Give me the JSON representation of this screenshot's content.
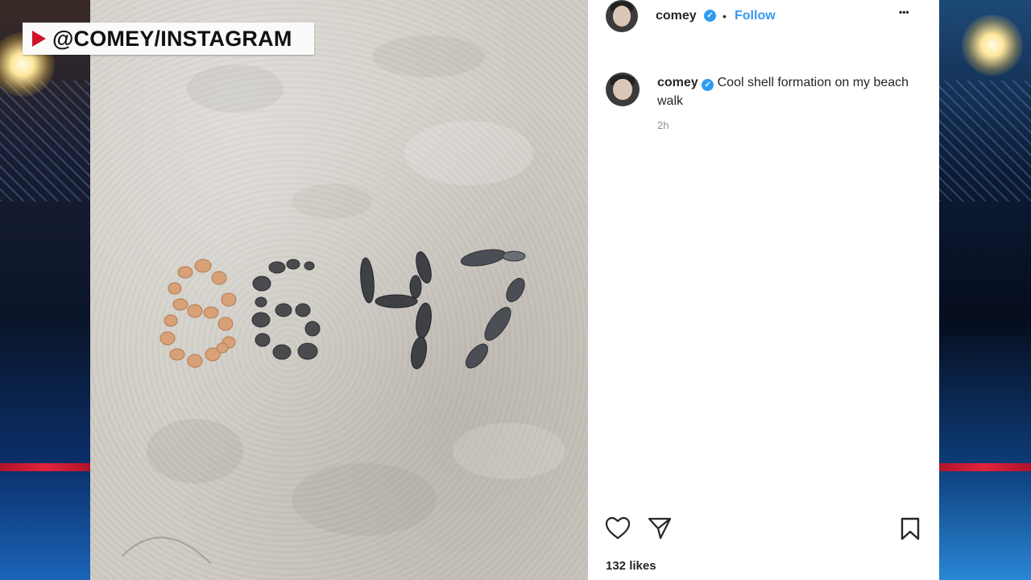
{
  "chyron": {
    "text": "@COMEY/INSTAGRAM"
  },
  "photo": {
    "description_icon": "beach-shell-photo",
    "shell_digits": [
      "8",
      "6",
      "4",
      "7"
    ]
  },
  "post": {
    "header": {
      "username": "comey",
      "separator": "•",
      "follow_label": "Follow",
      "more_label": "•••"
    },
    "caption": {
      "username": "comey",
      "text": "Cool shell formation on my beach walk"
    },
    "timestamp": "2h",
    "likes": "132 likes"
  },
  "colors": {
    "follow_blue": "#3897f0",
    "verified_blue": "#2f9bf0",
    "chyron_red": "#d0122d"
  }
}
